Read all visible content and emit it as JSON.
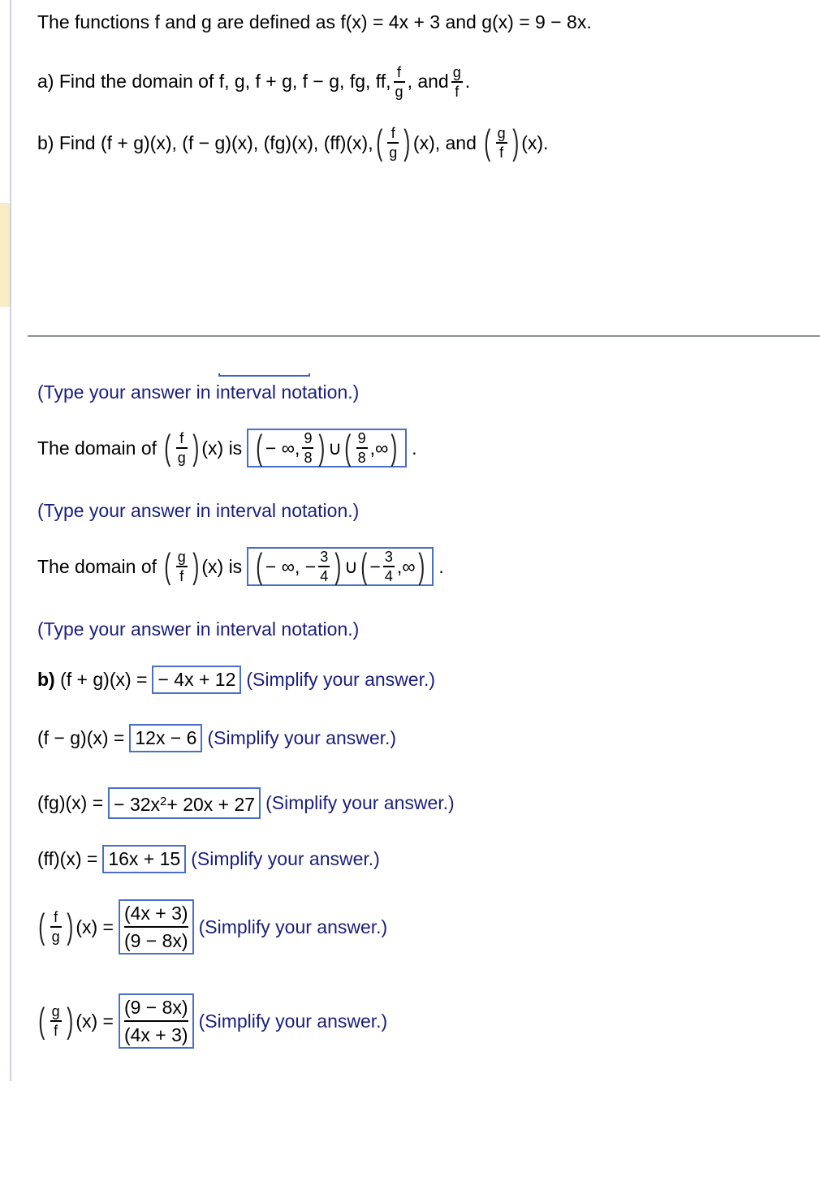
{
  "problem": {
    "intro": "The functions f and g are defined as f(x) = 4x + 3 and g(x) = 9 − 8x.",
    "part_a": {
      "prefix": "a) Find the domain of f, g, f + g, f − g, fg, ff,",
      "frac1": {
        "num": "f",
        "den": "g"
      },
      "and": ", and",
      "frac2": {
        "num": "g",
        "den": "f"
      },
      "suffix": "."
    },
    "part_b": {
      "prefix": "b) Find (f + g)(x), (f − g)(x), (fg)(x), (ff)(x),",
      "frac1": {
        "num": "f",
        "den": "g"
      },
      "mid": "(x), and",
      "frac2": {
        "num": "g",
        "den": "f"
      },
      "suffix": "(x)."
    }
  },
  "hints": {
    "interval": "(Type your answer in interval notation.)",
    "simplify": "(Simplify your answer.)"
  },
  "domain_fg": {
    "label": "The domain of",
    "frac": {
      "num": "f",
      "den": "g"
    },
    "is": "(x) is",
    "answer": {
      "left_open": "− ∞,",
      "left_frac": {
        "num": "9",
        "den": "8"
      },
      "union": "∪",
      "right_frac": {
        "num": "9",
        "den": "8"
      },
      "right_close": ",∞"
    },
    "period": "."
  },
  "domain_gf": {
    "label": "The domain of",
    "frac": {
      "num": "g",
      "den": "f"
    },
    "is": "(x) is",
    "answer": {
      "left_open": "− ∞, −",
      "left_frac": {
        "num": "3",
        "den": "4"
      },
      "union": "∪",
      "right_prefix": "−",
      "right_frac": {
        "num": "3",
        "den": "4"
      },
      "right_close": ",∞"
    },
    "period": "."
  },
  "sum": {
    "bold": "b)",
    "label": "(f + g)(x) =",
    "answer": "− 4x + 12"
  },
  "diff": {
    "label": "(f − g)(x) =",
    "answer": "12x − 6"
  },
  "prod": {
    "label": "(fg)(x) =",
    "answer_a": "− 32x",
    "answer_exp": "2",
    "answer_b": " + 20x + 27"
  },
  "square": {
    "label": "(ff)(x) =",
    "answer": "16x + 15"
  },
  "quot_fg": {
    "frac": {
      "num": "f",
      "den": "g"
    },
    "label": "(x) =",
    "answer_num": "(4x + 3)",
    "answer_den": "(9 − 8x)"
  },
  "quot_gf": {
    "frac": {
      "num": "g",
      "den": "f"
    },
    "label": "(x) =",
    "answer_num": "(9 − 8x)",
    "answer_den": "(4x + 3)"
  }
}
